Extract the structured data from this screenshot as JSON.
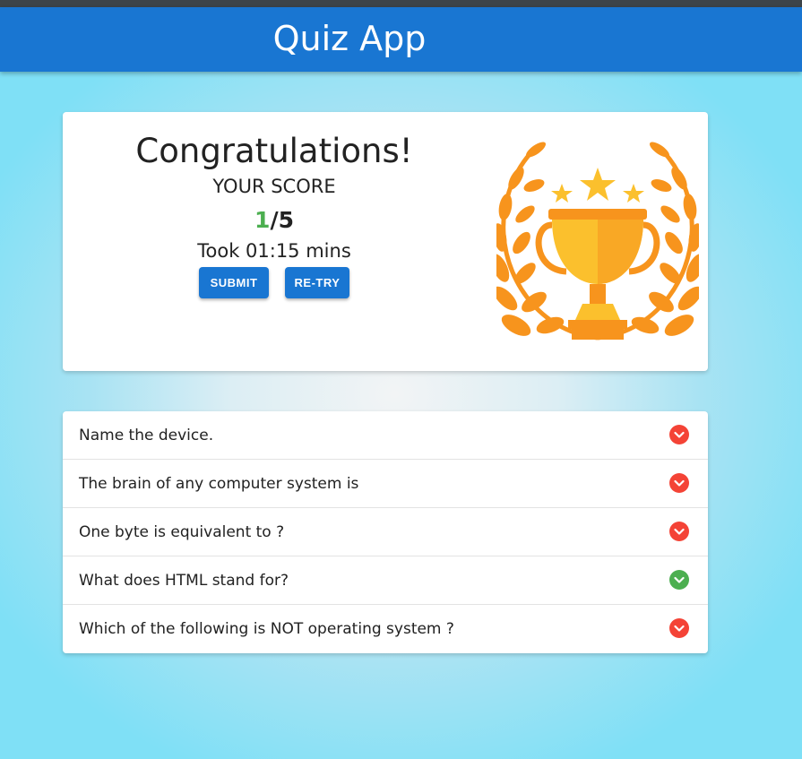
{
  "app": {
    "title": "Quiz App"
  },
  "result": {
    "heading": "Congratulations!",
    "score_label": "YOUR SCORE",
    "score_correct": "1",
    "score_total": "/5",
    "time_text": "Took 01:15 mins",
    "submit_label": "SUBMIT",
    "retry_label": "RE-TRY",
    "trophy_icon": "trophy-icon"
  },
  "questions": [
    {
      "text": "Name the device.",
      "status": "incorrect",
      "icon": "chevron-down-icon"
    },
    {
      "text": "The brain of any computer system is",
      "status": "incorrect",
      "icon": "chevron-down-icon"
    },
    {
      "text": "One byte is equivalent to ?",
      "status": "incorrect",
      "icon": "chevron-down-icon"
    },
    {
      "text": "What does HTML stand for?",
      "status": "correct",
      "icon": "chevron-down-icon"
    },
    {
      "text": "Which of the following is NOT operating system ?",
      "status": "incorrect",
      "icon": "chevron-down-icon"
    }
  ],
  "colors": {
    "primary": "#1976d2",
    "correct": "#4caf50",
    "incorrect": "#f44336",
    "trophy_gold": "#fbc02d",
    "laurel_orange": "#f7941d"
  }
}
